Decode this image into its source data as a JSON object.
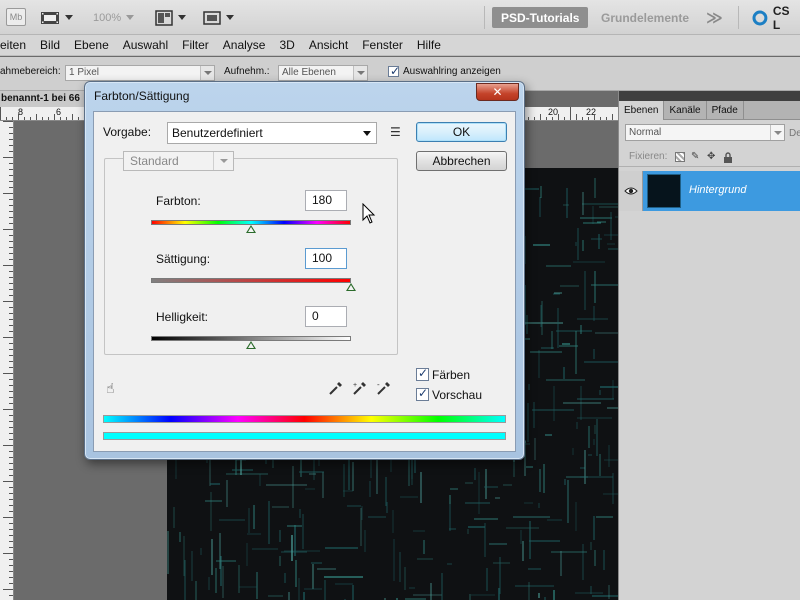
{
  "appbar": {
    "mb_label": "Mb",
    "zoom": "100%",
    "workspaces": [
      "PSD-Tutorials",
      "Grundelemente"
    ],
    "more_label": "≫",
    "cs_label": "CS L"
  },
  "menu": [
    "eiten",
    "Bild",
    "Ebene",
    "Auswahl",
    "Filter",
    "Analyse",
    "3D",
    "Ansicht",
    "Fenster",
    "Hilfe"
  ],
  "options": {
    "range_label": "ahmebereich:",
    "range_value": "1 Pixel",
    "sample_label": "Aufnehm.:",
    "sample_value": "Alle Ebenen",
    "ring_label": "Auswahlring anzeigen"
  },
  "document": {
    "tab_title": "benannt-1 bei 66",
    "ruler_numbers": [
      "8",
      "6",
      "20",
      "22"
    ]
  },
  "layers_panel": {
    "tabs": [
      "Ebenen",
      "Kanäle",
      "Pfade"
    ],
    "blend_mode": "Normal",
    "opacity_label": "De",
    "lock_label": "Fixieren:",
    "layer_name": "Hintergrund"
  },
  "dialog": {
    "title": "Farbton/Sättigung",
    "close_label": "✕",
    "preset_label": "Vorgabe:",
    "preset_value": "Benutzerdefiniert",
    "ok_label": "OK",
    "cancel_label": "Abbrechen",
    "channel": "Standard",
    "hue_label": "Farbton:",
    "hue_value": "180",
    "saturation_label": "Sättigung:",
    "saturation_value": "100",
    "lightness_label": "Helligkeit:",
    "lightness_value": "0",
    "hue_position": 0.5,
    "saturation_position": 1.0,
    "lightness_position": 0.5,
    "colorize_label": "Färben",
    "preview_label": "Vorschau"
  }
}
